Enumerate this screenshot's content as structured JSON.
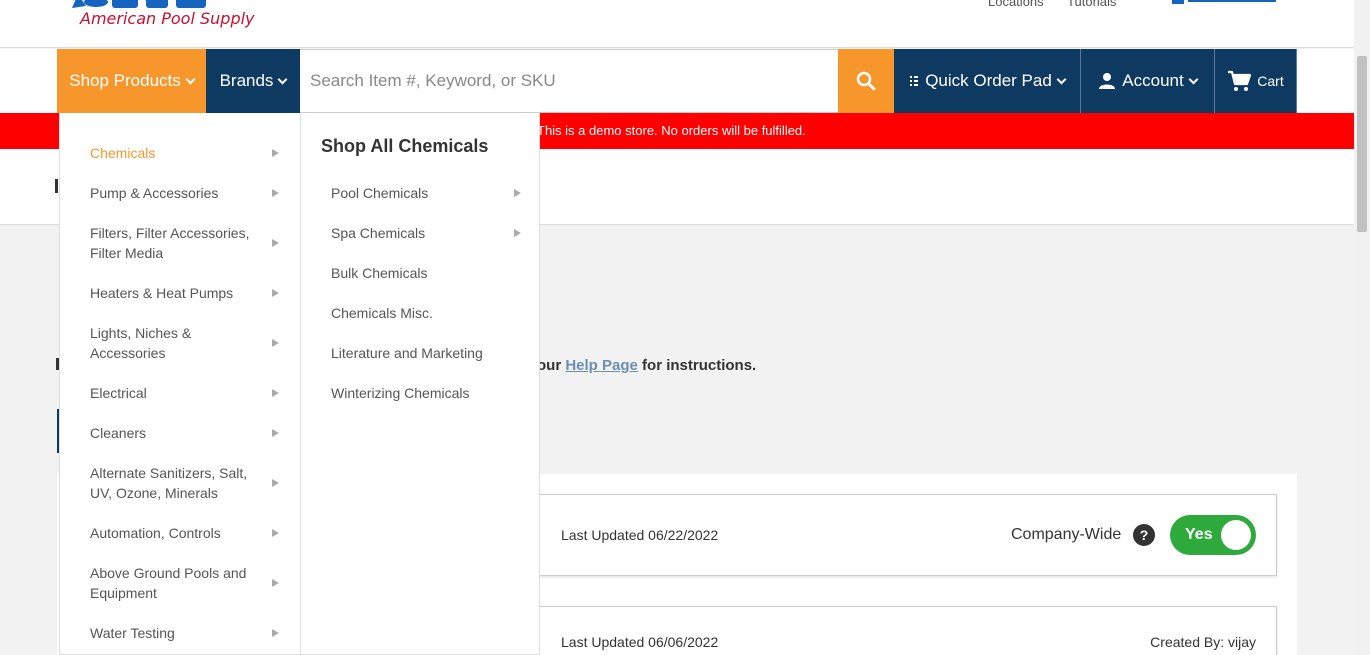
{
  "header": {
    "logo_text": "American Pool Supply",
    "top_links": [
      "Locations",
      "Tutorials"
    ],
    "brand_logo_icon": "heritage-logo"
  },
  "nav": {
    "shop_products": "Shop Products",
    "brands": "Brands",
    "search_placeholder": "Search Item #, Keyword, or SKU",
    "quick_order_pad": "Quick Order Pad",
    "account": "Account",
    "cart": "Cart"
  },
  "banner": {
    "text": "This is a demo store. No orders will be fulfilled."
  },
  "menu": {
    "categories": [
      {
        "label": "Chemicals"
      },
      {
        "label": "Pump & Accessories"
      },
      {
        "label": "Filters, Filter Accessories, Filter Media"
      },
      {
        "label": "Heaters & Heat Pumps"
      },
      {
        "label": "Lights, Niches & Accessories"
      },
      {
        "label": "Electrical"
      },
      {
        "label": "Cleaners"
      },
      {
        "label": "Alternate Sanitizers, Salt, UV, Ozone, Minerals"
      },
      {
        "label": "Automation, Controls"
      },
      {
        "label": "Above Ground Pools and Equipment"
      },
      {
        "label": "Water Testing"
      }
    ],
    "sub_title": "Shop All Chemicals",
    "sub_items": [
      {
        "label": "Pool Chemicals"
      },
      {
        "label": "Spa Chemicals"
      },
      {
        "label": "Bulk Chemicals"
      },
      {
        "label": "Chemicals Misc."
      },
      {
        "label": "Literature and Marketing"
      },
      {
        "label": "Winterizing Chemicals"
      }
    ]
  },
  "content": {
    "help_prefix": "our",
    "help_link": "Help Page",
    "help_suffix": "for instructions.",
    "cards": [
      {
        "updated": "Last Updated 06/22/2022",
        "company_label": "Company-Wide",
        "help": "?",
        "toggle": "Yes"
      },
      {
        "updated": "Last Updated 06/06/2022",
        "created_by": "Created By: vijay"
      }
    ]
  },
  "colors": {
    "navy": "#0e3a62",
    "orange": "#f6962b",
    "banner_red": "#ff0000",
    "toggle_green": "#2eaa3c"
  }
}
